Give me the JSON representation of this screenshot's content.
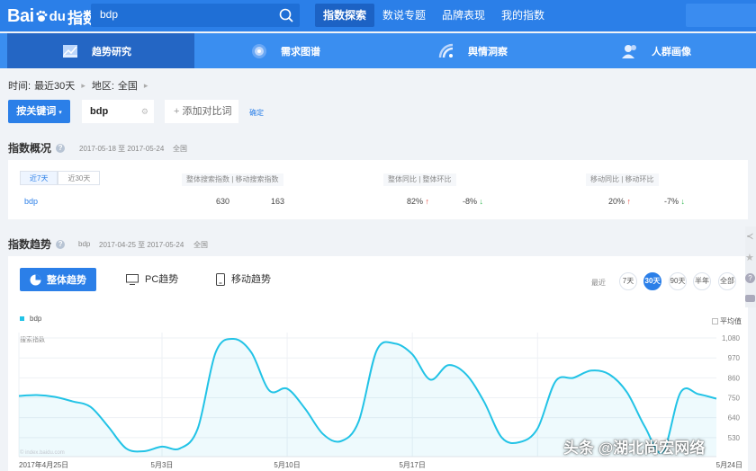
{
  "topbar": {
    "logo_text": "Bai",
    "logo_du": "du",
    "logo_zs": "指数",
    "search_value": "bdp",
    "nav": [
      "指数探索",
      "数说专题",
      "品牌表现",
      "我的指数"
    ]
  },
  "subnav": [
    "趋势研究",
    "需求图谱",
    "舆情洞察",
    "人群画像"
  ],
  "filters": {
    "time_label": "时间:",
    "time_value": "最近30天",
    "region_label": "地区:",
    "region_value": "全国",
    "keyword_button": "按关键词",
    "keyword_value": "bdp",
    "add_compare": "添加对比词",
    "confirm": "确定"
  },
  "overview": {
    "title": "指数概况",
    "date_range": "2017-05-18 至 2017-05-24",
    "region": "全国",
    "tabs": [
      "近7天",
      "近30天"
    ],
    "header_search": "整体搜索指数  |  移动搜索指数",
    "header_yoy": "整体同比  |  整体环比",
    "header_mobile": "移动同比  |  移动环比",
    "keyword": "bdp",
    "overall_index": "630",
    "mobile_index": "163",
    "overall_yoy": "82%",
    "overall_mom": "-8%",
    "mobile_yoy": "20%",
    "mobile_mom": "-7%"
  },
  "trend": {
    "title": "指数趋势",
    "keyword": "bdp",
    "date_range": "2017-04-25 至 2017-05-24",
    "region": "全国",
    "tabs": [
      "整体趋势",
      "PC趋势",
      "移动趋势"
    ],
    "range_label": "最近",
    "ranges": [
      "7天",
      "30天",
      "90天",
      "半年",
      "全部"
    ],
    "avg_label": "平均值",
    "y_title": "搜索指数",
    "source": "© index.baidu.com"
  },
  "chart_data": {
    "type": "area",
    "series": [
      {
        "name": "bdp",
        "values": [
          760,
          765,
          755,
          730,
          700,
          590,
          470,
          455,
          480,
          470,
          580,
          1000,
          1075,
          1000,
          790,
          800,
          690,
          550,
          510,
          620,
          1010,
          1050,
          990,
          850,
          930,
          880,
          730,
          530,
          505,
          580,
          840,
          860,
          900,
          880,
          780,
          590,
          450,
          780,
          770,
          745
        ]
      }
    ],
    "x_ticks": [
      "2017年4月25日",
      "5月3日",
      "5月10日",
      "5月17日",
      "5月24日"
    ],
    "y_ticks": [
      "1,080",
      "970",
      "860",
      "750",
      "640",
      "530"
    ],
    "ylim": [
      425,
      1110
    ],
    "xlim": [
      "2017-04-25",
      "2017-05-24"
    ],
    "color": "#22c3e6"
  },
  "watermark": "头条 @湖北尚宏网络"
}
